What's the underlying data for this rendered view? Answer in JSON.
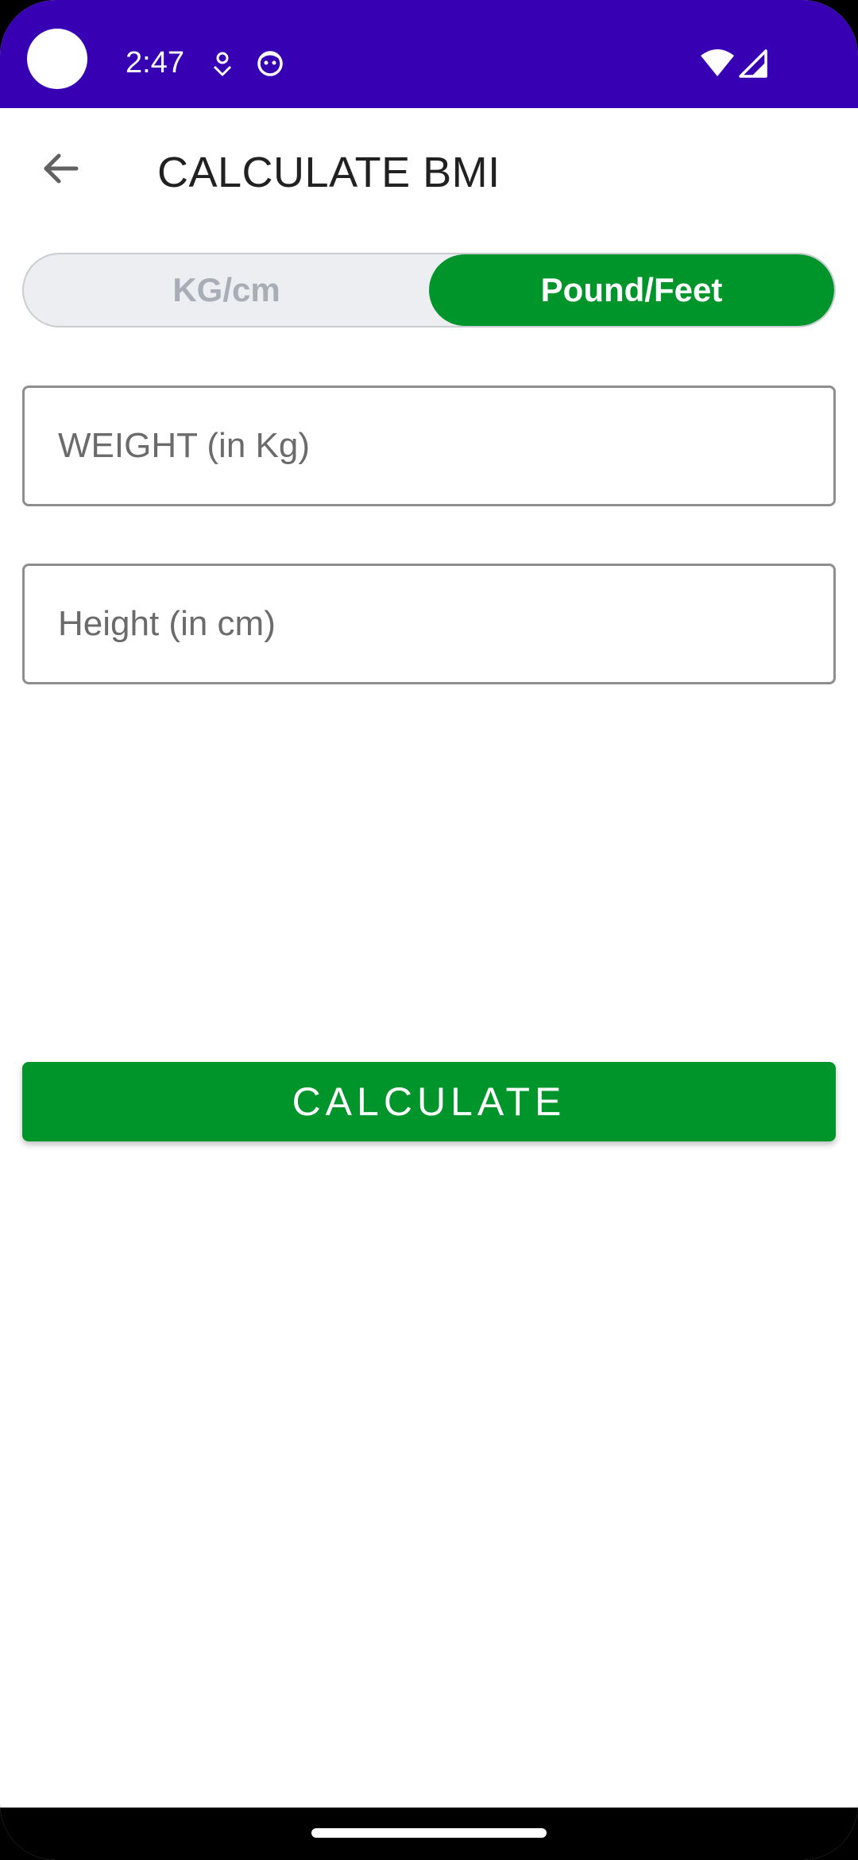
{
  "status_bar": {
    "time": "2:47",
    "background_color": "#3700b3",
    "icons_left": [
      "location-pin-icon",
      "face-icon"
    ],
    "icons_right": [
      "wifi-icon",
      "cellular-signal-icon"
    ]
  },
  "app_bar": {
    "back_icon": "arrow-left-icon",
    "title": "CALCULATE BMI"
  },
  "unit_toggle": {
    "options": [
      {
        "label": "KG/cm",
        "selected": false
      },
      {
        "label": "Pound/Feet",
        "selected": true
      }
    ],
    "active_color": "#00952a"
  },
  "form": {
    "weight_placeholder": "WEIGHT (in Kg)",
    "weight_value": "",
    "height_placeholder": "Height (in cm)",
    "height_value": ""
  },
  "actions": {
    "calculate_label": "CALCULATE"
  }
}
